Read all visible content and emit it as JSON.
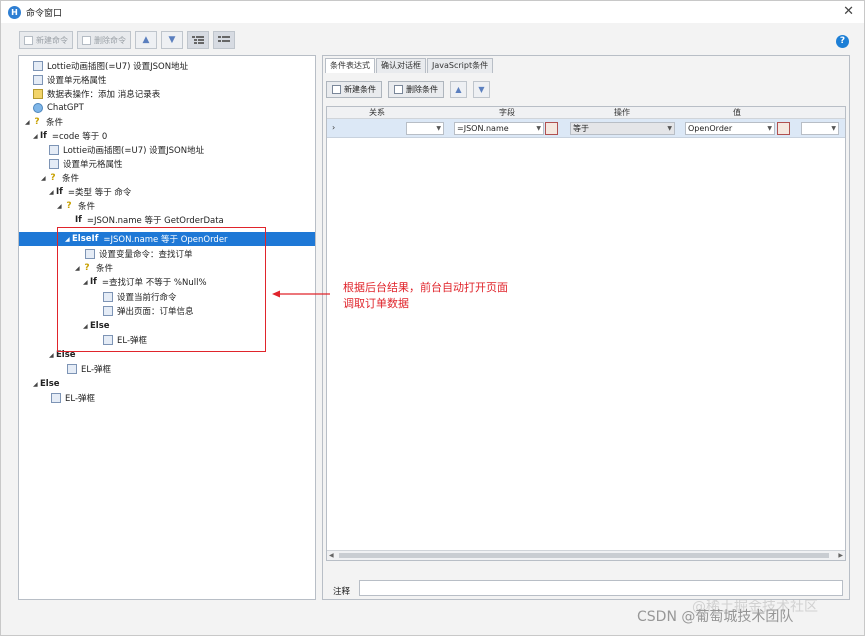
{
  "window": {
    "title": "命令窗口",
    "close_glyph": "✕"
  },
  "toolbar": {
    "new_command": "新建命令",
    "delete_command": "删除命令",
    "up_glyph": "▲",
    "down_glyph": "▼"
  },
  "help": {
    "glyph": "?"
  },
  "tree": {
    "rows": [
      {
        "text": "Lottie动画插图(=U7) 设置JSON地址"
      },
      {
        "text": "设置单元格属性"
      },
      {
        "text": "数据表操作：添加 消息记录表"
      },
      {
        "text": "ChatGPT"
      },
      {
        "text": "条件"
      },
      {
        "kw": "If",
        "text": "=code 等于 0"
      },
      {
        "text": "Lottie动画插图(=U7) 设置JSON地址"
      },
      {
        "text": "设置单元格属性"
      },
      {
        "text": "条件"
      },
      {
        "kw": "If",
        "text": "=类型 等于 命令"
      },
      {
        "text": "条件"
      },
      {
        "kw": "If",
        "text": "=JSON.name 等于 GetOrderData"
      },
      {
        "kw": "ElseIf",
        "text": "=JSON.name 等于 OpenOrder"
      },
      {
        "text": "设置变量命令：查找订单"
      },
      {
        "text": "条件"
      },
      {
        "kw": "If",
        "text": "=查找订单 不等于 %Null%"
      },
      {
        "text": "设置当前行命令"
      },
      {
        "text": "弹出页面：订单信息"
      },
      {
        "kw": "Else",
        "text": ""
      },
      {
        "text": "EL-弹框"
      },
      {
        "kw": "Else",
        "text": ""
      },
      {
        "text": "EL-弹框"
      },
      {
        "kw": "Else",
        "text": ""
      },
      {
        "text": "EL-弹框"
      }
    ]
  },
  "tabs": [
    "条件表达式",
    "确认对话框",
    "JavaScript条件"
  ],
  "condition_toolbar": {
    "new_condition": "新建条件",
    "delete_condition": "删除条件"
  },
  "grid": {
    "columns": [
      "关系",
      "字段",
      "操作",
      "值"
    ],
    "row": {
      "marker": "›",
      "relation": "",
      "field": "=JSON.name",
      "operation": "等于",
      "value": "OpenOrder"
    }
  },
  "note": {
    "label": "注释",
    "value": ""
  },
  "annotation": {
    "line1": "根据后台结果，前台自动打开页面",
    "line2": "调取订单数据"
  },
  "watermark": {
    "text": "CSDN @葡萄城技术团队",
    "text2": "@稀土掘金技术社区"
  },
  "colors": {
    "selection": "#1e78d6",
    "annotation_red": "#e0242b"
  }
}
